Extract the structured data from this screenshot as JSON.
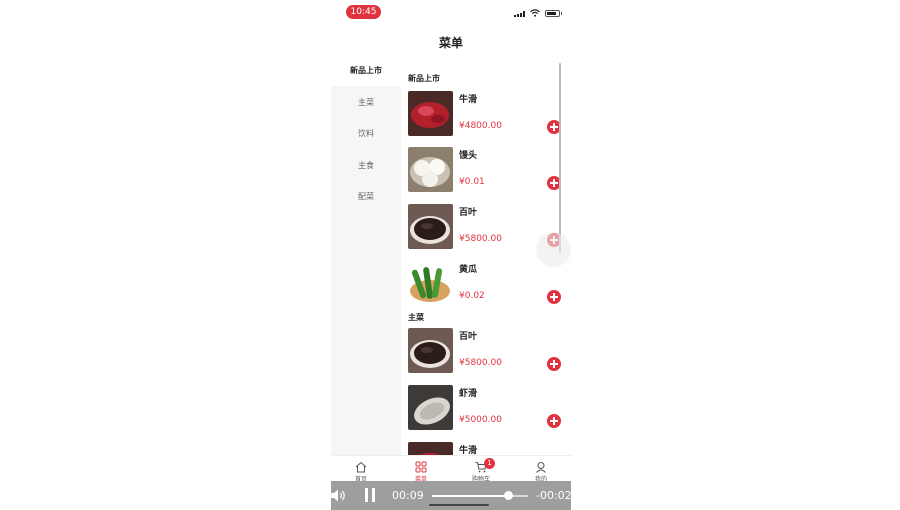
{
  "status": {
    "time": "10:45"
  },
  "page": {
    "title": "菜单"
  },
  "categories": [
    {
      "label": "新品上市",
      "active": true
    },
    {
      "label": "主菜",
      "active": false
    },
    {
      "label": "饮料",
      "active": false
    },
    {
      "label": "主食",
      "active": false
    },
    {
      "label": "配菜",
      "active": false
    }
  ],
  "sections": [
    {
      "title": "新品上市",
      "items": [
        {
          "name": "牛滑",
          "price": "¥4800.00",
          "image": "beef"
        },
        {
          "name": "馒头",
          "price": "¥0.01",
          "image": "bun"
        },
        {
          "name": "百叶",
          "price": "¥5800.00",
          "image": "tripe"
        },
        {
          "name": "黄瓜",
          "price": "¥0.02",
          "image": "cucumber"
        }
      ]
    },
    {
      "title": "主菜",
      "items": [
        {
          "name": "百叶",
          "price": "¥5800.00",
          "image": "tripe"
        },
        {
          "name": "虾滑",
          "price": "¥5000.00",
          "image": "shrimp"
        },
        {
          "name": "牛滑",
          "price": "",
          "image": "beef"
        }
      ]
    }
  ],
  "tabbar": {
    "tabs": [
      {
        "label": "首页",
        "icon": "home-icon"
      },
      {
        "label": "菜单",
        "icon": "menu-grid-icon"
      },
      {
        "label": "购物车",
        "icon": "cart-icon"
      },
      {
        "label": "我的",
        "icon": "user-icon"
      }
    ],
    "active": "菜单",
    "cart_count": "1"
  },
  "video": {
    "elapsed": "00:09",
    "remaining": "-00:02",
    "progress": 0.8
  },
  "colors": {
    "accent": "#e0333f",
    "sidebar_bg": "#f6f6f8"
  }
}
